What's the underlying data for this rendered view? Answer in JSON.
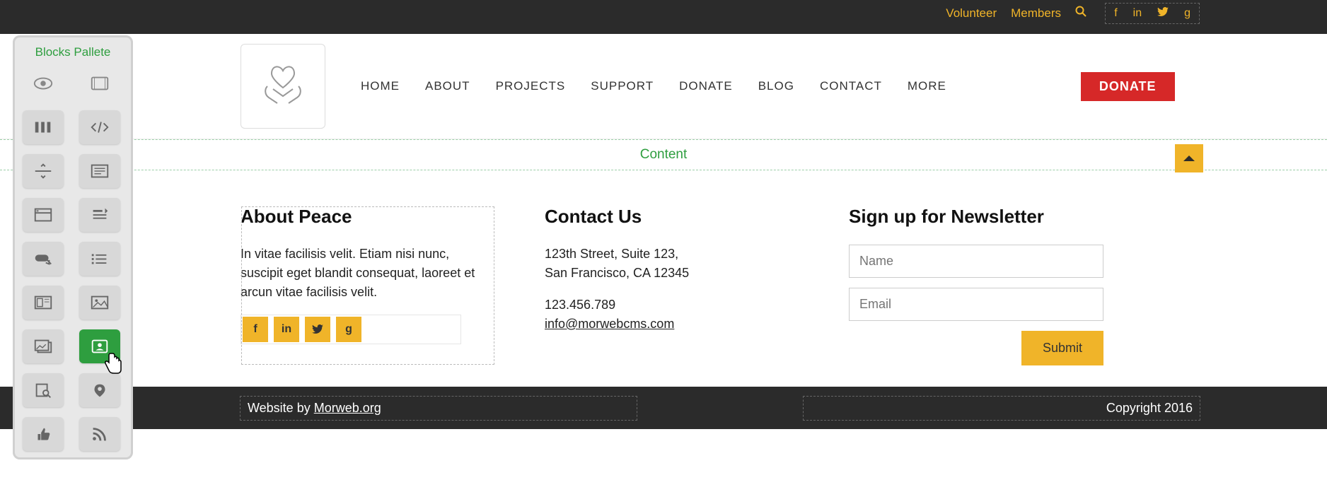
{
  "topbar": {
    "volunteer": "Volunteer",
    "members": "Members"
  },
  "palette": {
    "title": "Blocks Pallete"
  },
  "nav": {
    "home": "HOME",
    "about": "ABOUT",
    "projects": "PROJECTS",
    "support": "SUPPORT",
    "donate": "DONATE",
    "blog": "BLOG",
    "contact": "CONTACT",
    "more": "MORE"
  },
  "donate_btn": "DONATE",
  "content_label": "Content",
  "about": {
    "title": "About Peace",
    "text": "In vitae facilisis velit. Etiam nisi nunc, suscipit eget blandit consequat, laoreet et arcun vitae facilisis velit."
  },
  "contact": {
    "title": "Contact Us",
    "addr1": "123th Street, Suite 123,",
    "addr2": "San Francisco, CA 12345",
    "phone": "123.456.789",
    "email": "info@morwebcms.com"
  },
  "newsletter": {
    "title": "Sign up for Newsletter",
    "name_ph": "Name",
    "email_ph": "Email",
    "submit": "Submit"
  },
  "footer": {
    "website_by": "Website by ",
    "morweb": "Morweb.org",
    "copyright": "Copyright 2016"
  }
}
